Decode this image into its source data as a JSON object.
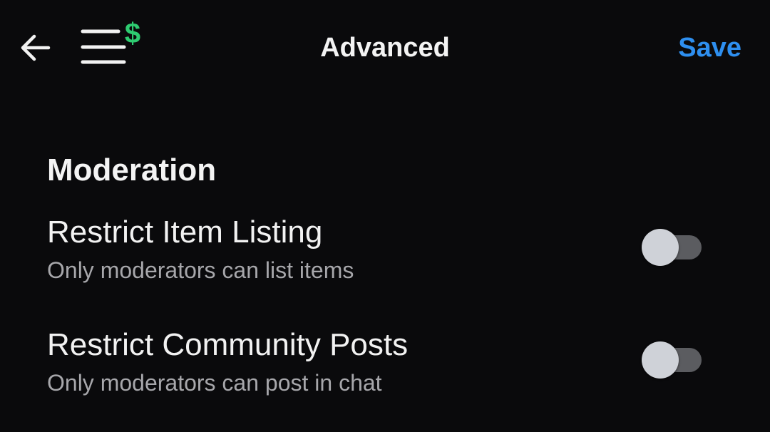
{
  "header": {
    "title": "Advanced",
    "save_label": "Save",
    "back_icon": "arrow-left-icon",
    "menu_icon": "menu-dollar-icon",
    "menu_badge": "$"
  },
  "section": {
    "title": "Moderation"
  },
  "settings": [
    {
      "label": "Restrict Item Listing",
      "description": "Only moderators can list items",
      "enabled": false
    },
    {
      "label": "Restrict Community Posts",
      "description": "Only moderators can post in chat",
      "enabled": false
    }
  ],
  "colors": {
    "background": "#0a0a0c",
    "accent_blue": "#2e8ff0",
    "badge_green": "#2ecc71",
    "toggle_track": "#5b5c60",
    "toggle_thumb": "#cfd2d8"
  }
}
